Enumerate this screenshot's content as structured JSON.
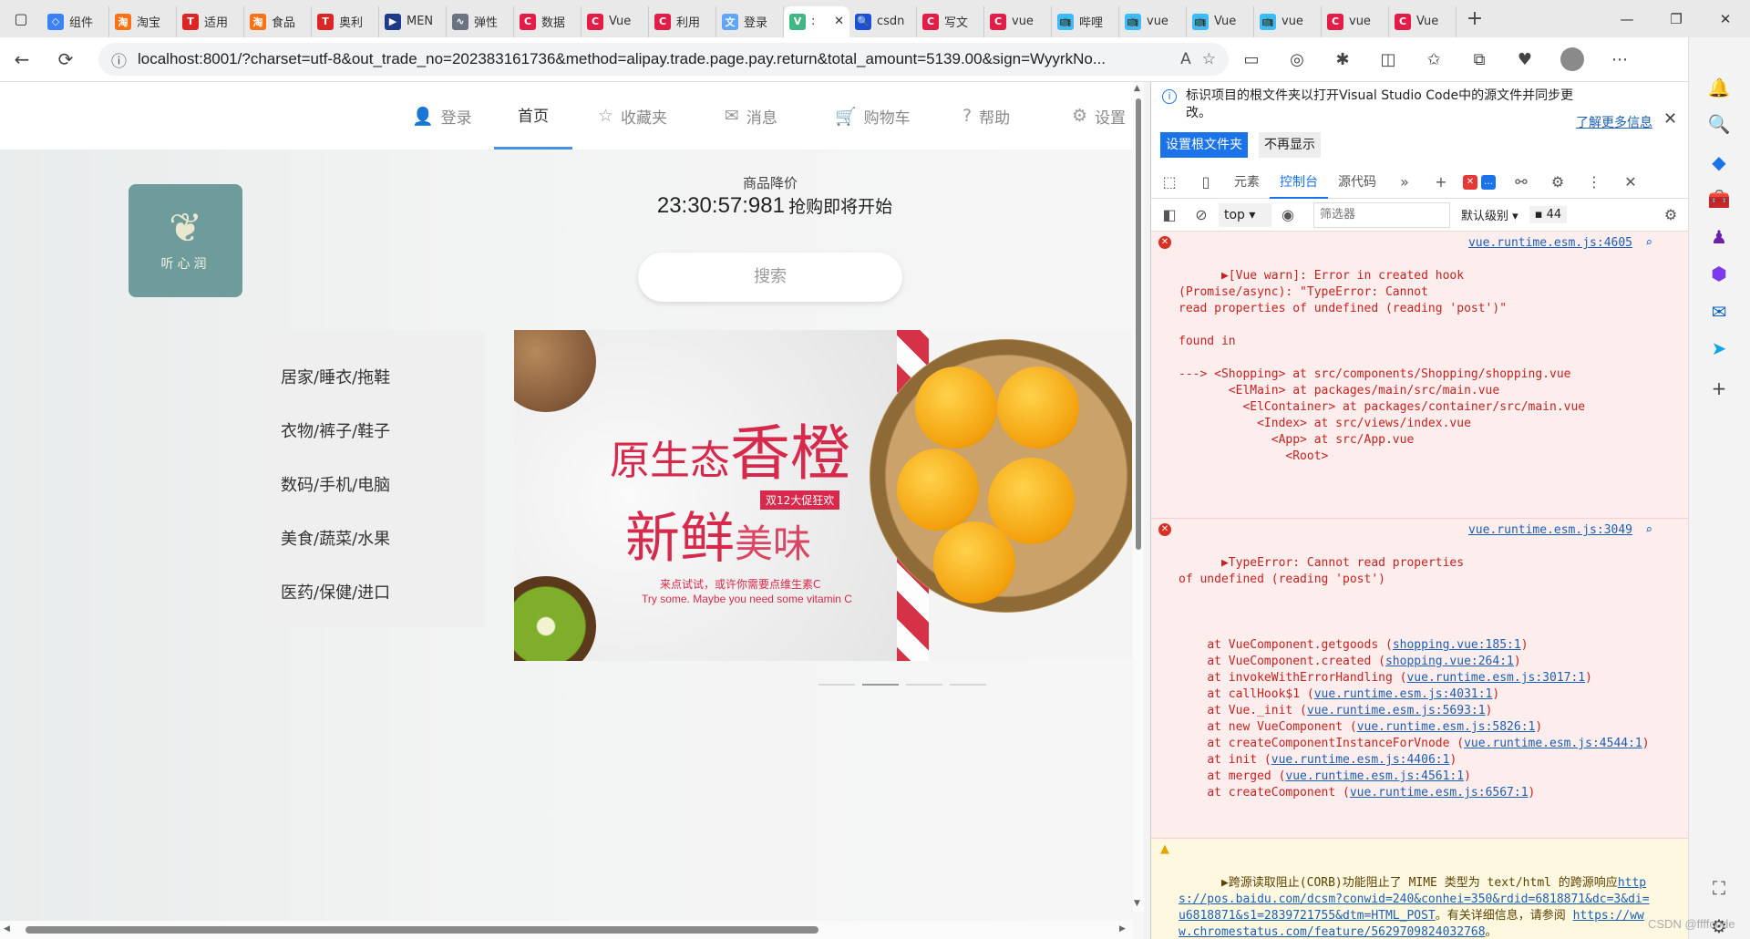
{
  "tabs": [
    {
      "label": "组件",
      "color": "#3b82f6",
      "glyph": "◇"
    },
    {
      "label": "淘宝",
      "color": "#f97316",
      "glyph": "淘"
    },
    {
      "label": "适用",
      "color": "#dc2626",
      "glyph": "T"
    },
    {
      "label": "食品",
      "color": "#f97316",
      "glyph": "淘"
    },
    {
      "label": "奥利",
      "color": "#dc2626",
      "glyph": "T"
    },
    {
      "label": "MEN",
      "color": "#1e3a8a",
      "glyph": "▶"
    },
    {
      "label": "弹性",
      "color": "#6b7280",
      "glyph": "∿"
    },
    {
      "label": "数据",
      "color": "#e11d48",
      "glyph": "C"
    },
    {
      "label": "Vue",
      "color": "#e11d48",
      "glyph": "C"
    },
    {
      "label": "利用",
      "color": "#e11d48",
      "glyph": "C"
    },
    {
      "label": "登录",
      "color": "#60a5fa",
      "glyph": "文"
    },
    {
      "label": ":",
      "color": "#41b883",
      "glyph": "V",
      "active": true
    },
    {
      "label": "csdn",
      "color": "#1d4ed8",
      "glyph": "🔍"
    },
    {
      "label": "写文",
      "color": "#e11d48",
      "glyph": "C"
    },
    {
      "label": "vue",
      "color": "#e11d48",
      "glyph": "C"
    },
    {
      "label": "哔哩",
      "color": "#38bdf8",
      "glyph": "📺"
    },
    {
      "label": "vue",
      "color": "#38bdf8",
      "glyph": "📺"
    },
    {
      "label": "Vue",
      "color": "#38bdf8",
      "glyph": "📺"
    },
    {
      "label": "vue",
      "color": "#38bdf8",
      "glyph": "📺"
    },
    {
      "label": "vue",
      "color": "#e11d48",
      "glyph": "C"
    },
    {
      "label": "Vue",
      "color": "#e11d48",
      "glyph": "C"
    }
  ],
  "address": {
    "url": "localhost:8001/?charset=utf-8&out_trade_no=202383161736&method=alipay.trade.page.pay.return&total_amount=5139.00&sign=WyyrkNo..."
  },
  "site": {
    "nav": [
      "登录",
      "首页",
      "收藏夹",
      "消息",
      "购物车",
      "帮助",
      "设置"
    ],
    "logo_text": "听心润",
    "sale_label": "商品降价",
    "countdown": "23:30:57:981",
    "countdown_text": "抢购即将开始",
    "search_label": "搜索",
    "categories": [
      "居家/睡衣/拖鞋",
      "衣物/裤子/鞋子",
      "数码/手机/电脑",
      "美食/蔬菜/水果",
      "医药/保健/进口"
    ],
    "banner": {
      "line1a": "原生态",
      "line1b": "香橙",
      "line2a": "新鲜",
      "line2b": "美味",
      "badge": "双12大促狂欢",
      "sub1": "来点试试，或许你需要点维生素C",
      "sub2": "Try some. Maybe you need some vitamin C"
    }
  },
  "devtools": {
    "info_msg": "标识项目的根文件夹以打开Visual Studio Code中的源文件并同步更改。",
    "learn_more": "了解更多信息",
    "set_root": "设置根文件夹",
    "dont_show": "不再显示",
    "tabs": [
      "元素",
      "控制台",
      "源代码"
    ],
    "context": "top",
    "filter_placeholder": "筛选器",
    "level": "默认级别",
    "issues": "44",
    "error1_text": "▶[Vue warn]: Error in created hook\n(Promise/async): \"TypeError: Cannot\nread properties of undefined (reading 'post')\"\n\nfound in\n\n---> <Shopping> at src/components/Shopping/shopping.vue\n       <ElMain> at packages/main/src/main.vue\n         <ElContainer> at packages/container/src/main.vue\n           <Index> at src/views/index.vue\n             <App> at src/App.vue\n               <Root>",
    "error1_src": "vue.runtime.esm.js:4605",
    "error2_head": "▶TypeError: Cannot read properties\nof undefined (reading 'post')",
    "error2_src": "vue.runtime.esm.js:3049",
    "stack": [
      {
        "fn": "    at VueComponent.getgoods (",
        "loc": "shopping.vue:185:1",
        "end": ")"
      },
      {
        "fn": "    at VueComponent.created (",
        "loc": "shopping.vue:264:1",
        "end": ")"
      },
      {
        "fn": "    at invokeWithErrorHandling (",
        "loc": "vue.runtime.esm.js:3017:1",
        "end": ")"
      },
      {
        "fn": "    at callHook$1 (",
        "loc": "vue.runtime.esm.js:4031:1",
        "end": ")"
      },
      {
        "fn": "    at Vue._init (",
        "loc": "vue.runtime.esm.js:5693:1",
        "end": ")"
      },
      {
        "fn": "    at new VueComponent (",
        "loc": "vue.runtime.esm.js:5826:1",
        "end": ")"
      },
      {
        "fn": "    at createComponentInstanceForVnode (",
        "loc": "vue.runtime.esm.js:4544:1",
        "end": ")"
      },
      {
        "fn": "    at init (",
        "loc": "vue.runtime.esm.js:4406:1",
        "end": ")"
      },
      {
        "fn": "    at merged (",
        "loc": "vue.runtime.esm.js:4561:1",
        "end": ")"
      },
      {
        "fn": "    at createComponent (",
        "loc": "vue.runtime.esm.js:6567:1",
        "end": ")"
      }
    ],
    "warn_text": "▶跨源读取阻止(CORB)功能阻止了 MIME 类型为 text/html 的跨源响应",
    "warn_link1": "https://pos.baidu.com/dcsm?conwid=240&conhei=350&rdid=6818871&dc=3&di=u6818871&s1=2839721755&dtm=HTML_POST",
    "warn_mid": "。有关详细信息，请参阅 ",
    "warn_link2": "https://www.chromestatus.com/feature/5629709824032768",
    "warn_end": "。"
  },
  "watermark": "CSDN @ffffcode"
}
